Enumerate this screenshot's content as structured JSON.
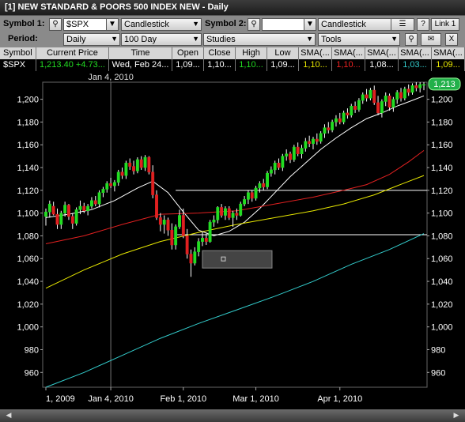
{
  "window": {
    "title": "[1] NEW STANDARD & POORS 500 INDEX NEW - Daily"
  },
  "toolbar": {
    "symbol1_label": "Symbol 1:",
    "symbol1_value": "$SPX",
    "chart_style_1": "Candlestick",
    "symbol2_label": "Symbol 2:",
    "symbol2_value": "",
    "chart_style_2": "Candlestick",
    "help_label": "?",
    "link_label": "Link 1",
    "close_label": "X",
    "period_label": "Period:",
    "period_value": "Daily",
    "range_value": "100 Day",
    "studies_value": "Studies",
    "tools_value": "Tools"
  },
  "quote": {
    "headers": [
      "Symbol",
      "Current Price",
      "Time",
      "Open",
      "Close",
      "High",
      "Low",
      "SMA(...",
      "SMA(...",
      "SMA(...",
      "SMA(...",
      "SMA(..."
    ],
    "values": [
      "$SPX",
      "1,213.40",
      "+4.73...",
      "Wed, Feb 24...",
      "1,09...",
      "1,10...",
      "1,10...",
      "1,09...",
      "1,10...",
      "1,10...",
      "1,08...",
      "1,03...",
      "1,09..."
    ],
    "colors": {
      "price": "#22dd22",
      "change": "#22dd22",
      "high": "#22dd22",
      "sma1": "#e8e800",
      "sma2": "#ee2222",
      "sma3": "#ffffff",
      "sma4": "#33cccc",
      "sma5": "#e8e800"
    }
  },
  "chart_data": {
    "type": "candlestick",
    "title": "",
    "cursor_date_label": "Jan 4, 2010",
    "last_price_label": "1,213",
    "y_ticks": [
      "1,200",
      "1,180",
      "1,160",
      "1,140",
      "1,120",
      "1,100",
      "1,080",
      "1,060",
      "1,040",
      "1,020",
      "1,000",
      "980",
      "960"
    ],
    "y_tick_values": [
      1200,
      1180,
      1160,
      1140,
      1120,
      1100,
      1080,
      1060,
      1040,
      1020,
      1000,
      980,
      960
    ],
    "ylim": [
      947,
      1215
    ],
    "x_ticks": [
      "1, 2009",
      "Jan 4, 2010",
      "Feb 1, 2010",
      "Mar 1, 2010",
      "Apr 1, 2010"
    ],
    "x_tick_index": [
      0,
      17,
      36,
      55,
      77
    ],
    "num_bars": 100,
    "candles": [
      {
        "o": 1097,
        "h": 1104,
        "l": 1089,
        "c": 1101
      },
      {
        "o": 1101,
        "h": 1111,
        "l": 1096,
        "c": 1108
      },
      {
        "o": 1106,
        "h": 1110,
        "l": 1098,
        "c": 1099
      },
      {
        "o": 1099,
        "h": 1104,
        "l": 1086,
        "c": 1090
      },
      {
        "o": 1090,
        "h": 1102,
        "l": 1086,
        "c": 1100
      },
      {
        "o": 1100,
        "h": 1110,
        "l": 1097,
        "c": 1107
      },
      {
        "o": 1107,
        "h": 1108,
        "l": 1094,
        "c": 1097
      },
      {
        "o": 1097,
        "h": 1100,
        "l": 1086,
        "c": 1091
      },
      {
        "o": 1091,
        "h": 1105,
        "l": 1089,
        "c": 1103
      },
      {
        "o": 1103,
        "h": 1111,
        "l": 1099,
        "c": 1106
      },
      {
        "o": 1106,
        "h": 1109,
        "l": 1100,
        "c": 1102
      },
      {
        "o": 1102,
        "h": 1108,
        "l": 1098,
        "c": 1106
      },
      {
        "o": 1106,
        "h": 1114,
        "l": 1104,
        "c": 1111
      },
      {
        "o": 1111,
        "h": 1115,
        "l": 1106,
        "c": 1108
      },
      {
        "o": 1108,
        "h": 1120,
        "l": 1105,
        "c": 1118
      },
      {
        "o": 1118,
        "h": 1123,
        "l": 1114,
        "c": 1121
      },
      {
        "o": 1121,
        "h": 1128,
        "l": 1118,
        "c": 1126
      },
      {
        "o": 1126,
        "h": 1131,
        "l": 1122,
        "c": 1124
      },
      {
        "o": 1124,
        "h": 1129,
        "l": 1119,
        "c": 1127
      },
      {
        "o": 1127,
        "h": 1138,
        "l": 1124,
        "c": 1136
      },
      {
        "o": 1136,
        "h": 1140,
        "l": 1130,
        "c": 1133
      },
      {
        "o": 1133,
        "h": 1146,
        "l": 1130,
        "c": 1144
      },
      {
        "o": 1144,
        "h": 1148,
        "l": 1138,
        "c": 1141
      },
      {
        "o": 1141,
        "h": 1146,
        "l": 1134,
        "c": 1137
      },
      {
        "o": 1137,
        "h": 1149,
        "l": 1135,
        "c": 1147
      },
      {
        "o": 1147,
        "h": 1150,
        "l": 1138,
        "c": 1140
      },
      {
        "o": 1140,
        "h": 1151,
        "l": 1137,
        "c": 1149
      },
      {
        "o": 1149,
        "h": 1150,
        "l": 1134,
        "c": 1136
      },
      {
        "o": 1136,
        "h": 1142,
        "l": 1113,
        "c": 1116
      },
      {
        "o": 1116,
        "h": 1120,
        "l": 1094,
        "c": 1096
      },
      {
        "o": 1096,
        "h": 1100,
        "l": 1084,
        "c": 1090
      },
      {
        "o": 1090,
        "h": 1098,
        "l": 1082,
        "c": 1094
      },
      {
        "o": 1094,
        "h": 1096,
        "l": 1080,
        "c": 1085
      },
      {
        "o": 1085,
        "h": 1091,
        "l": 1068,
        "c": 1072
      },
      {
        "o": 1072,
        "h": 1090,
        "l": 1068,
        "c": 1088
      },
      {
        "o": 1088,
        "h": 1103,
        "l": 1086,
        "c": 1098
      },
      {
        "o": 1098,
        "h": 1104,
        "l": 1078,
        "c": 1080
      },
      {
        "o": 1080,
        "h": 1086,
        "l": 1060,
        "c": 1064
      },
      {
        "o": 1064,
        "h": 1068,
        "l": 1044,
        "c": 1056
      },
      {
        "o": 1056,
        "h": 1070,
        "l": 1054,
        "c": 1066
      },
      {
        "o": 1066,
        "h": 1078,
        "l": 1062,
        "c": 1075
      },
      {
        "o": 1075,
        "h": 1084,
        "l": 1071,
        "c": 1078
      },
      {
        "o": 1078,
        "h": 1082,
        "l": 1072,
        "c": 1075
      },
      {
        "o": 1075,
        "h": 1094,
        "l": 1074,
        "c": 1092
      },
      {
        "o": 1092,
        "h": 1098,
        "l": 1088,
        "c": 1094
      },
      {
        "o": 1094,
        "h": 1106,
        "l": 1091,
        "c": 1105
      },
      {
        "o": 1105,
        "h": 1108,
        "l": 1096,
        "c": 1098
      },
      {
        "o": 1098,
        "h": 1106,
        "l": 1094,
        "c": 1104
      },
      {
        "o": 1104,
        "h": 1106,
        "l": 1094,
        "c": 1096
      },
      {
        "o": 1096,
        "h": 1102,
        "l": 1088,
        "c": 1100
      },
      {
        "o": 1100,
        "h": 1104,
        "l": 1094,
        "c": 1098
      },
      {
        "o": 1098,
        "h": 1110,
        "l": 1097,
        "c": 1108
      },
      {
        "o": 1108,
        "h": 1115,
        "l": 1106,
        "c": 1112
      },
      {
        "o": 1112,
        "h": 1120,
        "l": 1108,
        "c": 1118
      },
      {
        "o": 1118,
        "h": 1120,
        "l": 1110,
        "c": 1113
      },
      {
        "o": 1113,
        "h": 1124,
        "l": 1111,
        "c": 1122
      },
      {
        "o": 1122,
        "h": 1128,
        "l": 1118,
        "c": 1126
      },
      {
        "o": 1126,
        "h": 1130,
        "l": 1120,
        "c": 1123
      },
      {
        "o": 1123,
        "h": 1137,
        "l": 1121,
        "c": 1135
      },
      {
        "o": 1135,
        "h": 1141,
        "l": 1132,
        "c": 1138
      },
      {
        "o": 1138,
        "h": 1146,
        "l": 1134,
        "c": 1144
      },
      {
        "o": 1144,
        "h": 1148,
        "l": 1138,
        "c": 1140
      },
      {
        "o": 1140,
        "h": 1152,
        "l": 1137,
        "c": 1150
      },
      {
        "o": 1150,
        "h": 1156,
        "l": 1146,
        "c": 1152
      },
      {
        "o": 1152,
        "h": 1154,
        "l": 1144,
        "c": 1147
      },
      {
        "o": 1147,
        "h": 1160,
        "l": 1145,
        "c": 1158
      },
      {
        "o": 1158,
        "h": 1162,
        "l": 1150,
        "c": 1152
      },
      {
        "o": 1152,
        "h": 1160,
        "l": 1148,
        "c": 1157
      },
      {
        "o": 1157,
        "h": 1166,
        "l": 1154,
        "c": 1163
      },
      {
        "o": 1163,
        "h": 1168,
        "l": 1158,
        "c": 1161
      },
      {
        "o": 1161,
        "h": 1167,
        "l": 1156,
        "c": 1165
      },
      {
        "o": 1165,
        "h": 1170,
        "l": 1160,
        "c": 1163
      },
      {
        "o": 1163,
        "h": 1172,
        "l": 1161,
        "c": 1170
      },
      {
        "o": 1170,
        "h": 1178,
        "l": 1166,
        "c": 1175
      },
      {
        "o": 1175,
        "h": 1180,
        "l": 1170,
        "c": 1173
      },
      {
        "o": 1173,
        "h": 1182,
        "l": 1171,
        "c": 1180
      },
      {
        "o": 1180,
        "h": 1186,
        "l": 1176,
        "c": 1183
      },
      {
        "o": 1183,
        "h": 1188,
        "l": 1178,
        "c": 1180
      },
      {
        "o": 1180,
        "h": 1190,
        "l": 1178,
        "c": 1188
      },
      {
        "o": 1188,
        "h": 1192,
        "l": 1183,
        "c": 1186
      },
      {
        "o": 1186,
        "h": 1196,
        "l": 1184,
        "c": 1194
      },
      {
        "o": 1194,
        "h": 1198,
        "l": 1188,
        "c": 1191
      },
      {
        "o": 1191,
        "h": 1201,
        "l": 1189,
        "c": 1199
      },
      {
        "o": 1199,
        "h": 1206,
        "l": 1196,
        "c": 1204
      },
      {
        "o": 1204,
        "h": 1209,
        "l": 1198,
        "c": 1201
      },
      {
        "o": 1201,
        "h": 1210,
        "l": 1199,
        "c": 1208
      },
      {
        "o": 1208,
        "h": 1212,
        "l": 1195,
        "c": 1197
      },
      {
        "o": 1197,
        "h": 1203,
        "l": 1186,
        "c": 1188
      },
      {
        "o": 1188,
        "h": 1200,
        "l": 1184,
        "c": 1198
      },
      {
        "o": 1198,
        "h": 1206,
        "l": 1194,
        "c": 1203
      },
      {
        "o": 1203,
        "h": 1205,
        "l": 1190,
        "c": 1193
      },
      {
        "o": 1193,
        "h": 1202,
        "l": 1189,
        "c": 1200
      },
      {
        "o": 1200,
        "h": 1208,
        "l": 1196,
        "c": 1206
      },
      {
        "o": 1206,
        "h": 1210,
        "l": 1198,
        "c": 1201
      },
      {
        "o": 1201,
        "h": 1211,
        "l": 1199,
        "c": 1209
      },
      {
        "o": 1209,
        "h": 1213,
        "l": 1203,
        "c": 1206
      },
      {
        "o": 1206,
        "h": 1214,
        "l": 1204,
        "c": 1212
      },
      {
        "o": 1212,
        "h": 1215,
        "l": 1207,
        "c": 1210
      },
      {
        "o": 1210,
        "h": 1215,
        "l": 1206,
        "c": 1213
      },
      {
        "o": 1213,
        "h": 1215,
        "l": 1208,
        "c": 1213
      }
    ],
    "series": [
      {
        "color": "#ffffff",
        "points": [
          [
            0,
            1096
          ],
          [
            6,
            1099
          ],
          [
            12,
            1103
          ],
          [
            18,
            1111
          ],
          [
            24,
            1122
          ],
          [
            28,
            1128
          ],
          [
            32,
            1118
          ],
          [
            36,
            1101
          ],
          [
            40,
            1085
          ],
          [
            44,
            1080
          ],
          [
            48,
            1084
          ],
          [
            52,
            1092
          ],
          [
            56,
            1104
          ],
          [
            60,
            1118
          ],
          [
            64,
            1132
          ],
          [
            68,
            1144
          ],
          [
            72,
            1156
          ],
          [
            76,
            1166
          ],
          [
            80,
            1175
          ],
          [
            84,
            1183
          ],
          [
            88,
            1188
          ],
          [
            92,
            1194
          ],
          [
            96,
            1199
          ],
          [
            99,
            1203
          ]
        ]
      },
      {
        "color": "#e02020",
        "points": [
          [
            0,
            1073
          ],
          [
            10,
            1080
          ],
          [
            20,
            1090
          ],
          [
            30,
            1099
          ],
          [
            40,
            1100
          ],
          [
            50,
            1102
          ],
          [
            60,
            1108
          ],
          [
            70,
            1114
          ],
          [
            78,
            1120
          ],
          [
            84,
            1125
          ],
          [
            90,
            1134
          ],
          [
            95,
            1145
          ],
          [
            99,
            1155
          ]
        ]
      },
      {
        "color": "#e8e800",
        "points": [
          [
            0,
            1034
          ],
          [
            10,
            1050
          ],
          [
            20,
            1064
          ],
          [
            30,
            1075
          ],
          [
            40,
            1083
          ],
          [
            50,
            1090
          ],
          [
            60,
            1096
          ],
          [
            70,
            1102
          ],
          [
            78,
            1108
          ],
          [
            86,
            1116
          ],
          [
            92,
            1124
          ],
          [
            99,
            1133
          ]
        ]
      },
      {
        "color": "#33cccc",
        "points": [
          [
            0,
            947
          ],
          [
            10,
            960
          ],
          [
            20,
            975
          ],
          [
            30,
            990
          ],
          [
            40,
            1003
          ],
          [
            50,
            1015
          ],
          [
            60,
            1027
          ],
          [
            70,
            1040
          ],
          [
            80,
            1055
          ],
          [
            90,
            1068
          ],
          [
            99,
            1082
          ]
        ]
      }
    ],
    "hlines": [
      1120,
      1081
    ]
  },
  "status": {}
}
